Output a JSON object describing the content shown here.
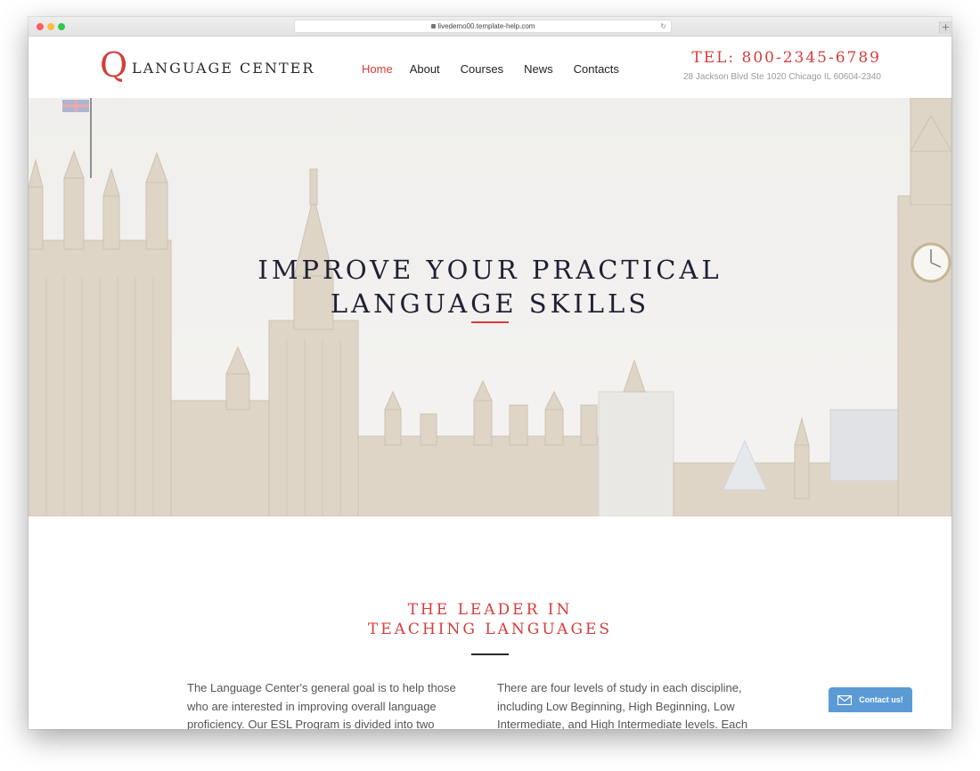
{
  "browser": {
    "url": "livedemo00.template-help.com",
    "new_tab_glyph": "+"
  },
  "header": {
    "logo_letter": "Q",
    "logo_text": "LANGUAGE CENTER",
    "nav": [
      "Home",
      "About",
      "Courses",
      "News",
      "Contacts"
    ],
    "active_nav": "Home",
    "tel": "TEL: 800-2345-6789",
    "address": "28 Jackson Blvd Ste 1020 Chicago IL 60604-2340"
  },
  "hero": {
    "title_line1": "IMPROVE YOUR PRACTICAL",
    "title_line2": "LANGUAGE SKILLS"
  },
  "section": {
    "heading_line1": "THE LEADER IN",
    "heading_line2": "TEACHING LANGUAGES",
    "col_left": "The Language Center's general goal is to help those who are interested in improving overall language proficiency. Our ESL Program is divided into two",
    "col_right": "There are four levels of study in each discipline, including Low Beginning, High Beginning, Low Intermediate, and High Intermediate levels. Each class"
  },
  "contact_widget": {
    "label": "Contact us!"
  },
  "colors": {
    "accent": "#d63d3a",
    "dark": "#1f2033",
    "widget": "#5b9bd5"
  }
}
